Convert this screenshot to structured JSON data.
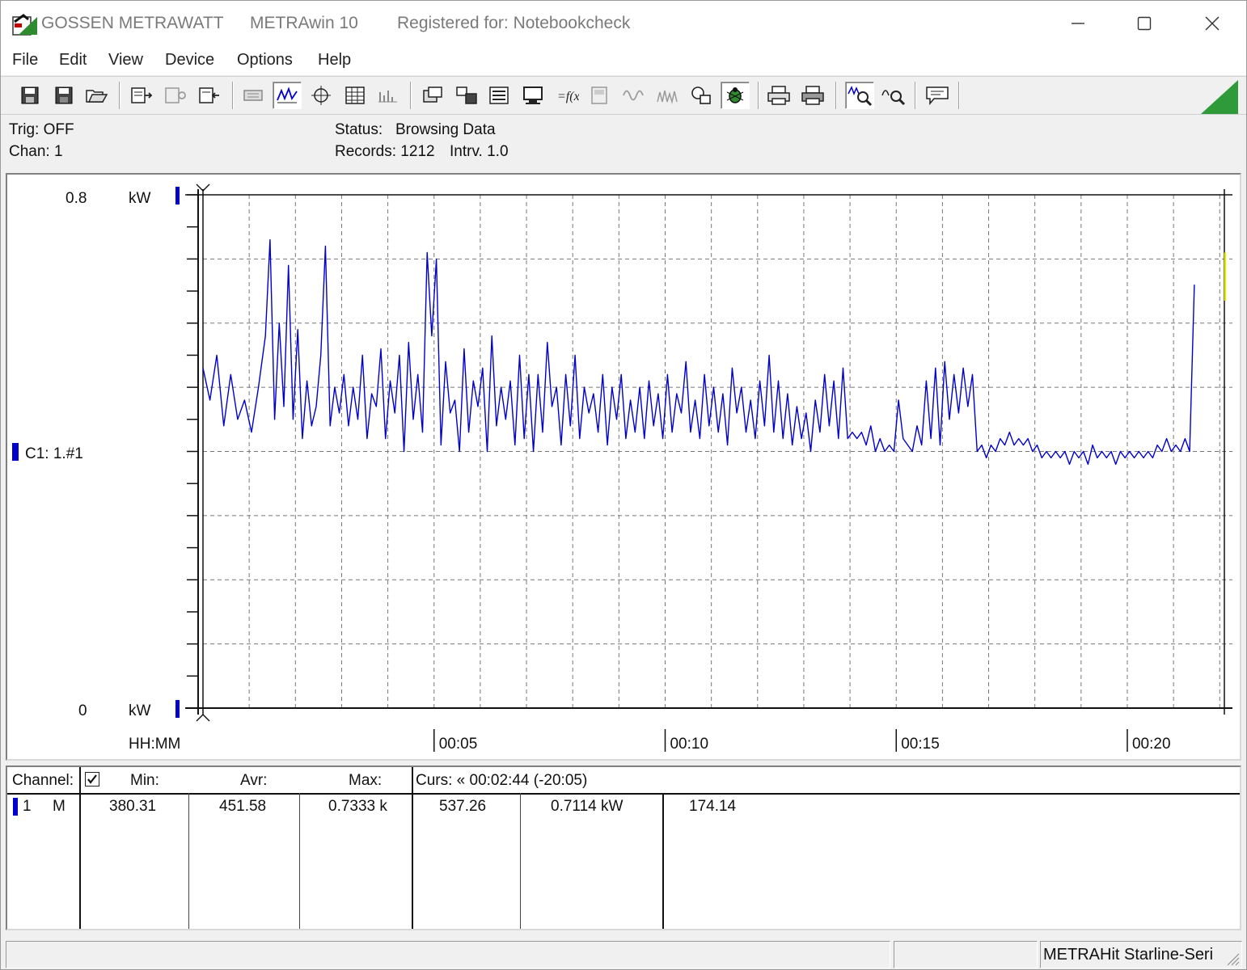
{
  "titlebar": {
    "brand": "GOSSEN METRAWATT",
    "app": "METRAwin 10",
    "registered": "Registered for: Notebookcheck",
    "icons": [
      "minimize-icon",
      "maximize-icon",
      "close-icon"
    ]
  },
  "menu": [
    "File",
    "Edit",
    "View",
    "Device",
    "Options",
    "Help"
  ],
  "info": {
    "trig": "Trig: OFF",
    "chan": "Chan:  1",
    "status_label": "Status:",
    "status_value": "Browsing Data",
    "records": "Records: 1212",
    "interval": "Intrv. 1.0"
  },
  "plot": {
    "y_top_value": "0.8",
    "y_top_unit": "kW",
    "y_bottom_value": "0",
    "y_bottom_unit": "kW",
    "channel_label": "C1: 1.#1",
    "x_unit_label": "HH:MM",
    "x_ticks": [
      "00:05",
      "00:10",
      "00:15",
      "00:20"
    ],
    "series_color": "#0000cc",
    "cursor_color": "#e6e600"
  },
  "chart_data": {
    "type": "line",
    "ylim": [
      0,
      0.8
    ],
    "xlim_minutes": [
      0,
      22.1
    ],
    "x_tick_labels": [
      "00:05",
      "00:10",
      "00:15",
      "00:20"
    ],
    "grid": true,
    "series": [
      {
        "unit": "kW",
        "x_minutes": [
          0,
          0.15,
          0.3,
          0.45,
          0.6,
          0.75,
          0.9,
          1.05,
          1.2,
          1.35,
          1.45,
          1.55,
          1.65,
          1.75,
          1.85,
          1.95,
          2.05,
          2.15,
          2.25,
          2.35,
          2.45,
          2.55,
          2.65,
          2.75,
          2.85,
          2.95,
          3.05,
          3.15,
          3.25,
          3.35,
          3.45,
          3.55,
          3.65,
          3.75,
          3.85,
          3.95,
          4.05,
          4.15,
          4.25,
          4.35,
          4.45,
          4.55,
          4.65,
          4.75,
          4.85,
          4.95,
          5.05,
          5.15,
          5.25,
          5.35,
          5.45,
          5.55,
          5.65,
          5.75,
          5.85,
          5.95,
          6.05,
          6.15,
          6.25,
          6.35,
          6.45,
          6.55,
          6.65,
          6.75,
          6.85,
          6.95,
          7.05,
          7.15,
          7.25,
          7.35,
          7.45,
          7.55,
          7.65,
          7.75,
          7.85,
          7.95,
          8.05,
          8.15,
          8.25,
          8.35,
          8.45,
          8.55,
          8.65,
          8.75,
          8.85,
          8.95,
          9.05,
          9.15,
          9.25,
          9.35,
          9.45,
          9.55,
          9.65,
          9.75,
          9.85,
          9.95,
          10.05,
          10.15,
          10.25,
          10.35,
          10.45,
          10.55,
          10.65,
          10.75,
          10.85,
          10.95,
          11.05,
          11.15,
          11.25,
          11.35,
          11.45,
          11.55,
          11.65,
          11.75,
          11.85,
          11.95,
          12.05,
          12.15,
          12.25,
          12.35,
          12.45,
          12.55,
          12.65,
          12.75,
          12.85,
          12.95,
          13.05,
          13.15,
          13.25,
          13.35,
          13.45,
          13.55,
          13.65,
          13.75,
          13.85,
          13.95,
          14.05,
          14.15,
          14.25,
          14.35,
          14.45,
          14.55,
          14.65,
          14.75,
          14.85,
          14.95,
          15.05,
          15.15,
          15.25,
          15.35,
          15.45,
          15.55,
          15.65,
          15.75,
          15.85,
          15.95,
          16.05,
          16.15,
          16.25,
          16.35,
          16.45,
          16.55,
          16.65,
          16.75,
          16.85,
          16.95,
          17.05,
          17.15,
          17.25,
          17.35,
          17.45,
          17.55,
          17.65,
          17.75,
          17.85,
          17.95,
          18.05,
          18.15,
          18.25,
          18.35,
          18.45,
          18.55,
          18.65,
          18.75,
          18.85,
          18.95,
          19.05,
          19.15,
          19.25,
          19.35,
          19.45,
          19.55,
          19.65,
          19.75,
          19.85,
          19.95,
          20.05,
          20.15,
          20.25,
          20.35,
          20.45,
          20.55,
          20.65,
          20.75,
          20.85,
          20.95,
          21.05,
          21.15,
          21.25,
          21.35,
          21.45,
          21.55,
          21.65,
          21.75,
          21.85,
          21.95,
          22.05,
          22.1
        ],
        "y_kw": [
          0.53,
          0.48,
          0.55,
          0.44,
          0.52,
          0.45,
          0.48,
          0.43,
          0.5,
          0.58,
          0.73,
          0.45,
          0.6,
          0.47,
          0.69,
          0.45,
          0.59,
          0.42,
          0.51,
          0.44,
          0.47,
          0.55,
          0.72,
          0.44,
          0.5,
          0.46,
          0.52,
          0.44,
          0.5,
          0.45,
          0.55,
          0.42,
          0.49,
          0.47,
          0.56,
          0.42,
          0.51,
          0.46,
          0.55,
          0.4,
          0.57,
          0.45,
          0.52,
          0.43,
          0.71,
          0.58,
          0.7,
          0.41,
          0.54,
          0.46,
          0.48,
          0.4,
          0.56,
          0.43,
          0.51,
          0.47,
          0.53,
          0.4,
          0.58,
          0.44,
          0.5,
          0.45,
          0.51,
          0.41,
          0.55,
          0.42,
          0.52,
          0.4,
          0.52,
          0.43,
          0.57,
          0.47,
          0.5,
          0.41,
          0.52,
          0.44,
          0.55,
          0.42,
          0.5,
          0.46,
          0.49,
          0.43,
          0.52,
          0.41,
          0.5,
          0.45,
          0.52,
          0.42,
          0.48,
          0.43,
          0.5,
          0.42,
          0.51,
          0.44,
          0.49,
          0.42,
          0.52,
          0.43,
          0.49,
          0.46,
          0.54,
          0.43,
          0.48,
          0.42,
          0.52,
          0.44,
          0.5,
          0.43,
          0.49,
          0.41,
          0.53,
          0.46,
          0.5,
          0.43,
          0.48,
          0.42,
          0.51,
          0.44,
          0.55,
          0.43,
          0.51,
          0.42,
          0.49,
          0.41,
          0.47,
          0.42,
          0.46,
          0.4,
          0.48,
          0.43,
          0.52,
          0.44,
          0.51,
          0.42,
          0.53,
          0.42,
          0.43,
          0.42,
          0.43,
          0.41,
          0.44,
          0.4,
          0.42,
          0.4,
          0.41,
          0.4,
          0.48,
          0.42,
          0.41,
          0.4,
          0.44,
          0.41,
          0.51,
          0.42,
          0.53,
          0.41,
          0.54,
          0.45,
          0.52,
          0.46,
          0.53,
          0.47,
          0.52,
          0.4,
          0.41,
          0.39,
          0.41,
          0.4,
          0.42,
          0.41,
          0.43,
          0.41,
          0.42,
          0.41,
          0.42,
          0.4,
          0.41,
          0.39,
          0.4,
          0.39,
          0.4,
          0.39,
          0.4,
          0.38,
          0.4,
          0.39,
          0.4,
          0.38,
          0.41,
          0.39,
          0.4,
          0.39,
          0.4,
          0.38,
          0.4,
          0.39,
          0.4,
          0.39,
          0.4,
          0.39,
          0.4,
          0.39,
          0.41,
          0.4,
          0.42,
          0.4,
          0.41,
          0.4,
          0.42,
          0.4,
          0.66
        ]
      }
    ]
  },
  "table": {
    "headers": {
      "channel": "Channel:",
      "min": "Min:",
      "avr": "Avr:",
      "max": "Max:",
      "curs": "Curs: « 00:02:44 (-20:05)"
    },
    "row": {
      "channel_no": "1",
      "mode": "M",
      "min": "380.31",
      "avr": "451.58",
      "max": "0.7333 k",
      "curs1": "537.26",
      "curs2": "0.7114  kW",
      "curs3": "174.14"
    }
  },
  "statusbar": {
    "device": "METRAHit Starline-Seri"
  },
  "toolbar_icons": [
    "save-icon",
    "save-as-icon",
    "open-icon",
    "device-read-icon",
    "device-config-icon",
    "device-send-icon",
    "print-preview-icon",
    "line-graph-icon",
    "crosshair-icon",
    "table-icon",
    "bar-graph-icon",
    "window-icon",
    "multi-window-icon",
    "list-icon",
    "monitor-icon",
    "function-icon",
    "meter-icon",
    "waveform-icon",
    "spectrum-icon",
    "copy-icon",
    "bug-icon",
    "printer-icon",
    "printer-2-icon",
    "zoom-graph-icon",
    "zoom-icon",
    "comment-icon"
  ]
}
